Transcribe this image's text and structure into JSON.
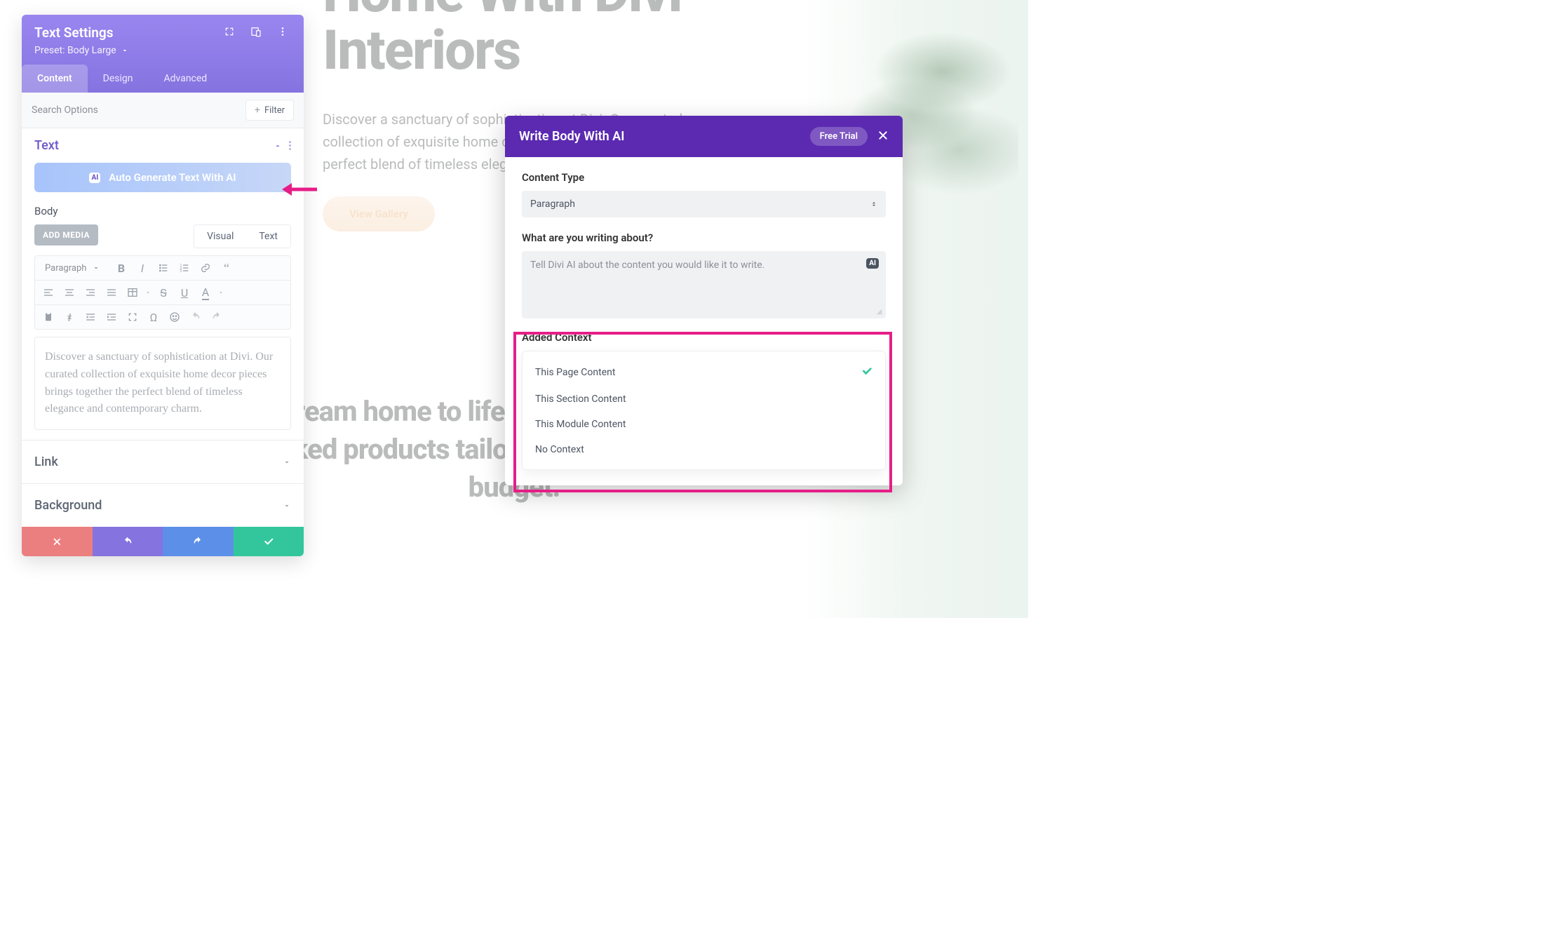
{
  "bg": {
    "heroLine1": "Home With Divi",
    "heroLine2": "Interiors",
    "heroDesc": "Discover a sanctuary of sophistication at Divi. Our curated collection of exquisite home decor pieces brings together the perfect blend of timeless elegance and contemporary charm.",
    "viewGallery": "View Gallery",
    "secondary": "Bring your dream home to life with one-on-one design help & hand-picked products tailored to your style, space, and budget."
  },
  "settings": {
    "title": "Text Settings",
    "preset": "Preset: Body Large",
    "tabs": [
      "Content",
      "Design",
      "Advanced"
    ],
    "activeTab": 0,
    "searchPlaceholder": "Search Options",
    "filterLabel": "Filter",
    "section": {
      "title": "Text",
      "aiButton": "Auto Generate Text With AI",
      "aiBadge": "AI",
      "bodyLabel": "Body",
      "addMedia": "ADD MEDIA",
      "vtTabs": [
        "Visual",
        "Text"
      ],
      "tbSelect": "Paragraph",
      "editorText": "Discover a sanctuary of sophistication at Divi. Our curated collection of exquisite home decor pieces brings together the perfect blend of timeless elegance and contemporary charm."
    },
    "accordions": [
      "Link",
      "Background"
    ]
  },
  "ai": {
    "title": "Write Body With AI",
    "freeTrial": "Free Trial",
    "contentTypeLabel": "Content Type",
    "contentTypeValue": "Paragraph",
    "promptLabel": "What are you writing about?",
    "promptPlaceholder": "Tell Divi AI about the content you would like it to write.",
    "promptBadge": "AI",
    "contextLabel": "Added Context",
    "contextItems": [
      {
        "label": "This Page Content",
        "selected": true
      },
      {
        "label": "This Section Content",
        "selected": false
      },
      {
        "label": "This Module Content",
        "selected": false
      },
      {
        "label": "No Context",
        "selected": false
      }
    ]
  }
}
